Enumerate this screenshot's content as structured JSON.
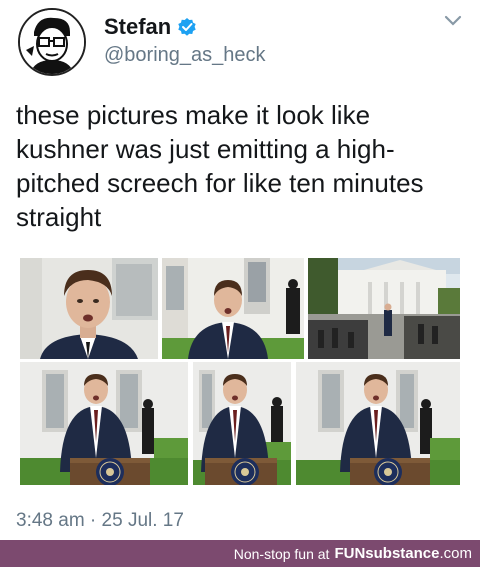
{
  "user": {
    "name": "Stefan",
    "handle": "@boring_as_heck"
  },
  "tweet": {
    "text": "these pictures make it look like kushner was just emitting a high-pitched screech for like ten minutes straight",
    "timestamp": "3:48 am · 25 Jul. 17"
  },
  "footer": {
    "text": "Non-stop fun at",
    "brand_main": "FUNsubstance",
    "brand_suffix": ".com"
  },
  "colors": {
    "verified": "#1da1f2",
    "footer_bg": "#7c4a6f",
    "handle": "#657786"
  },
  "icons": [
    "avatar-drawing",
    "verified-badge-icon",
    "chevron-down-icon",
    "podium-seal-icon"
  ]
}
